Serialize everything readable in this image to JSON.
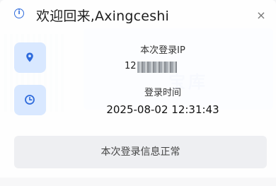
{
  "dialog": {
    "title": "欢迎回来,Axingceshi",
    "close_glyph": "×",
    "info_icon_glyph": "i"
  },
  "login_ip": {
    "label": "本次登录IP",
    "value_visible": "12"
  },
  "login_time": {
    "label": "登录时间",
    "value": "2025-08-02 12:31:43"
  },
  "status": {
    "message": "本次登录信息正常"
  },
  "background": {
    "banner_text": "宝库"
  },
  "colors": {
    "accent": "#2f6bdc",
    "icon_box_bg": "#d9e8ff",
    "status_bg": "#eeeff2"
  },
  "icons": {
    "title": "info-icon",
    "ip": "location-pin-icon",
    "time": "clock-icon",
    "close": "close-icon"
  }
}
